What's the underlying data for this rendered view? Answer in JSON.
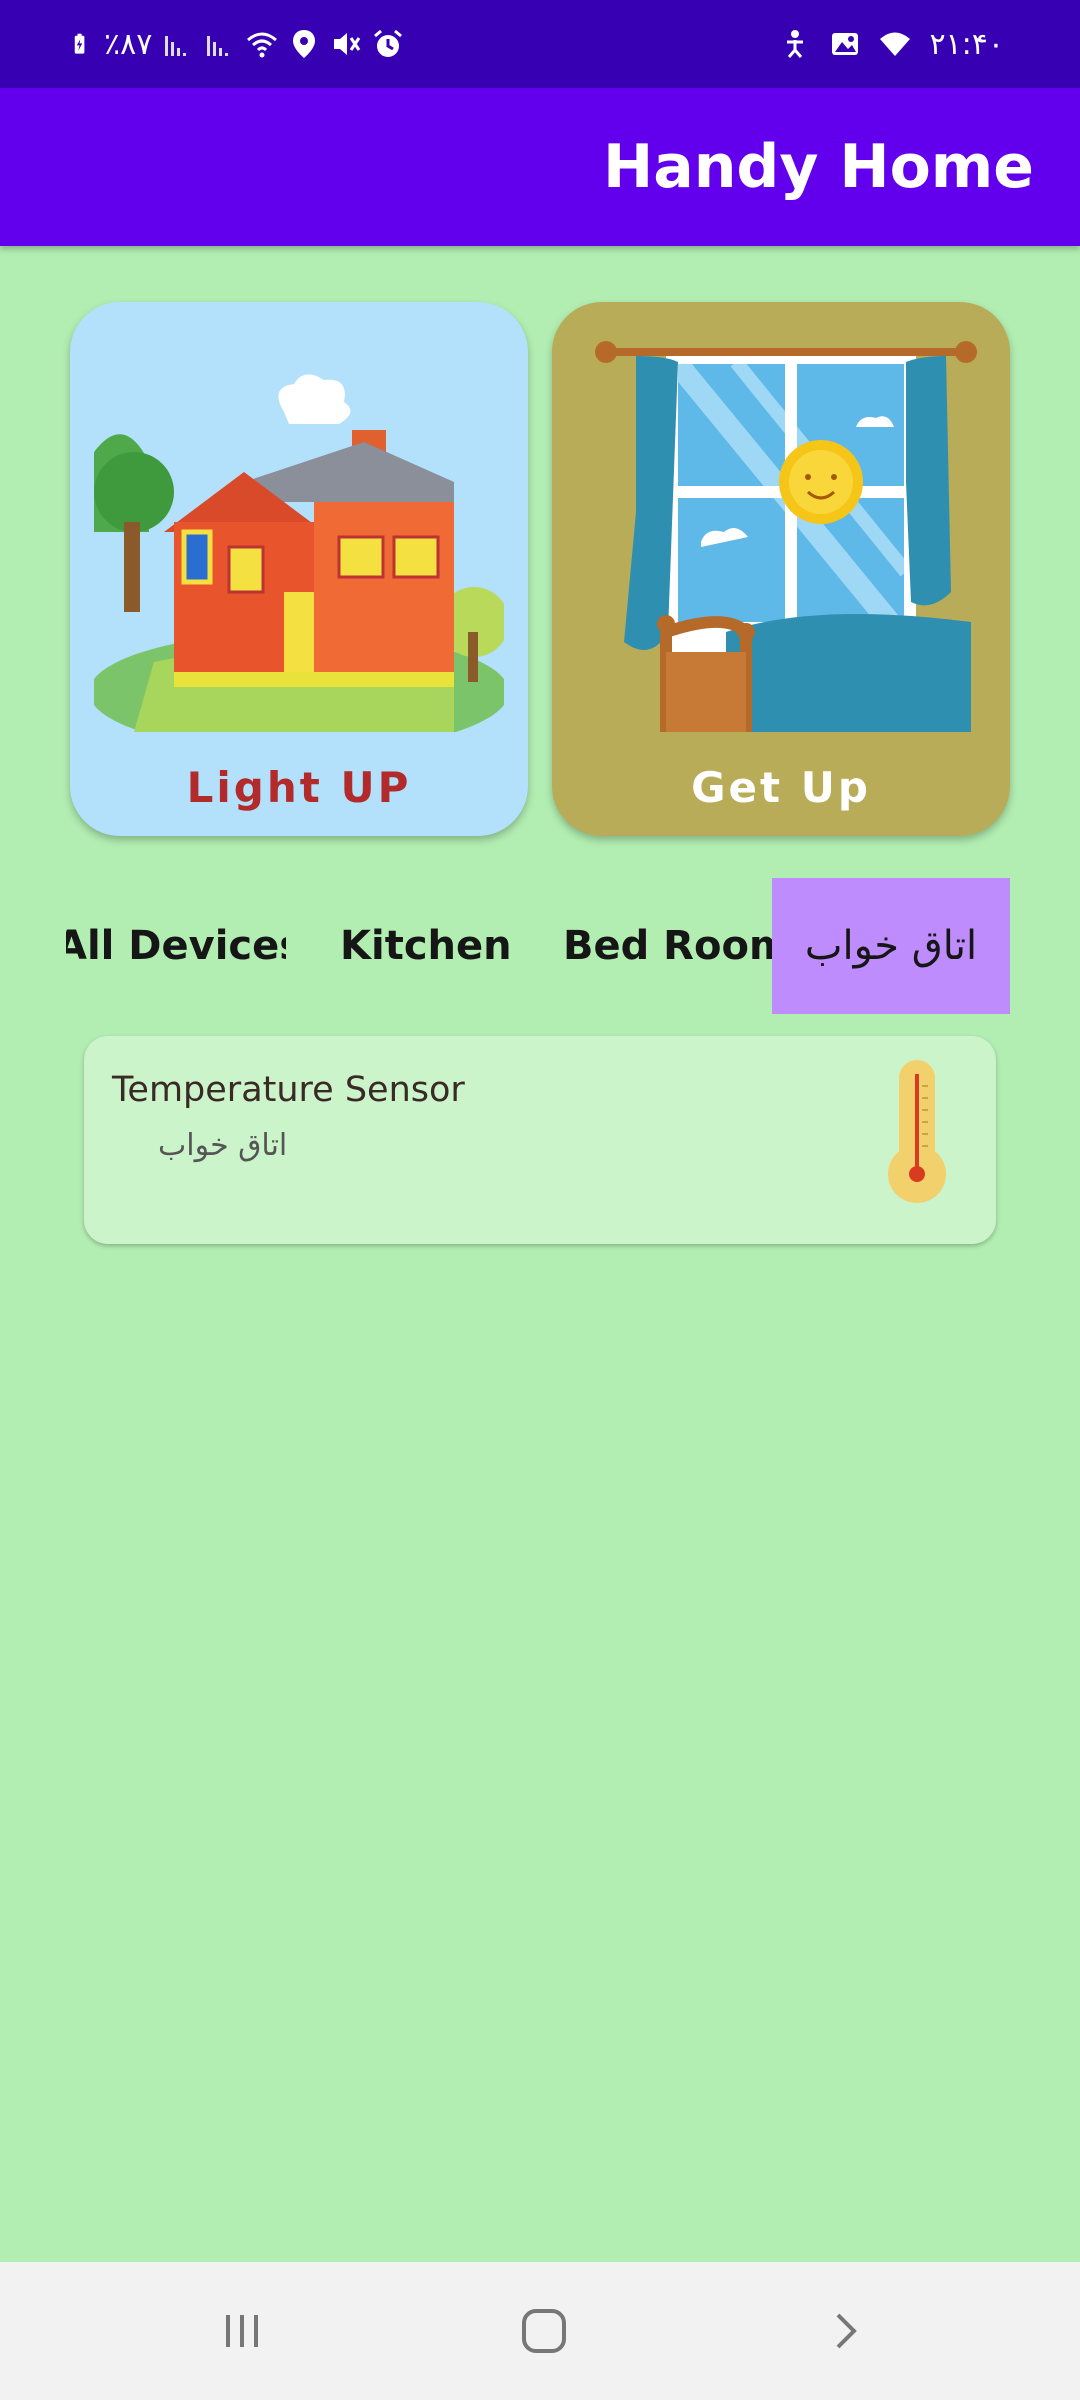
{
  "status_bar": {
    "battery_text": "٪۸۷",
    "time": "۲۱:۴۰"
  },
  "app_bar": {
    "title": "Handy Home"
  },
  "cards": [
    {
      "label": "Light UP"
    },
    {
      "label": "Get Up"
    }
  ],
  "tabs": [
    {
      "label": "All Devices"
    },
    {
      "label": "Kitchen"
    },
    {
      "label": "Bed Room"
    },
    {
      "label": "اتاق خواب",
      "selected": true
    }
  ],
  "devices": [
    {
      "name": "Temperature Sensor",
      "room": "اتاق خواب",
      "icon": "thermometer-icon"
    }
  ],
  "colors": {
    "status_bar": "#3700b3",
    "app_bar": "#6200ee",
    "background": "#b2eeb2",
    "selected_tab": "#bf8cfd",
    "device_card": "#cbf4cb"
  },
  "nav": {
    "icons": [
      "recent-apps-icon",
      "home-icon",
      "back-icon"
    ]
  }
}
